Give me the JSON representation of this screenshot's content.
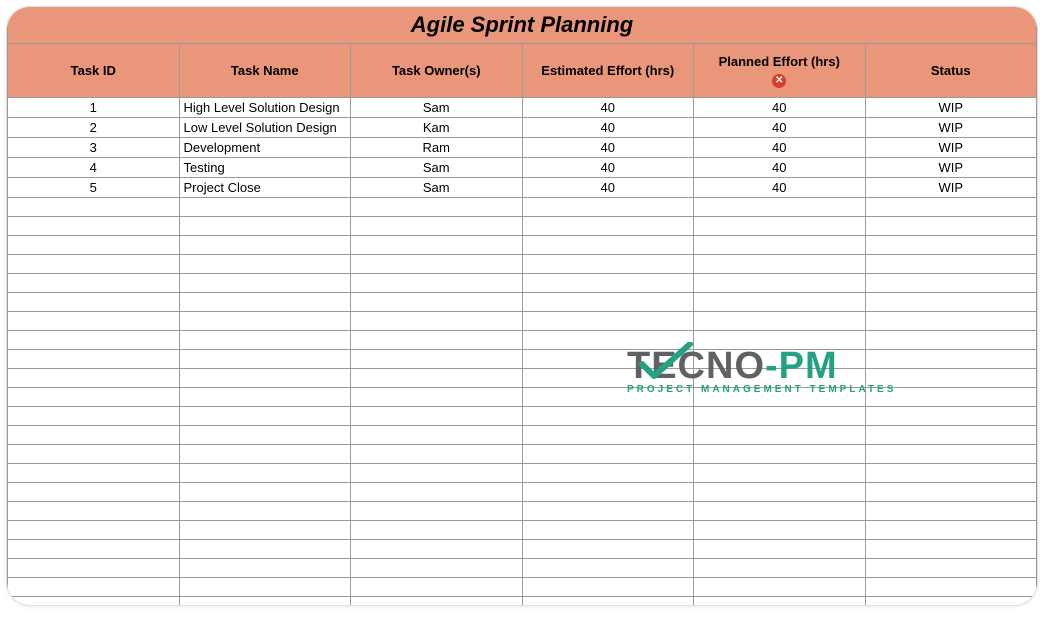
{
  "title": "Agile Sprint Planning",
  "headers": {
    "task_id": "Task ID",
    "task_name": "Task Name",
    "task_owner": "Task Owner(s)",
    "estimated": "Estimated Effort (hrs)",
    "planned": "Planned Effort (hrs)",
    "status": "Status"
  },
  "rows": [
    {
      "id": "1",
      "name": "High Level Solution Design",
      "owner": "Sam",
      "est": "40",
      "plan": "40",
      "status": "WIP"
    },
    {
      "id": "2",
      "name": "Low Level Solution Design",
      "owner": "Kam",
      "est": "40",
      "plan": "40",
      "status": "WIP"
    },
    {
      "id": "3",
      "name": "Development",
      "owner": "Ram",
      "est": "40",
      "plan": "40",
      "status": "WIP"
    },
    {
      "id": "4",
      "name": "Testing",
      "owner": "Sam",
      "est": "40",
      "plan": "40",
      "status": "WIP"
    },
    {
      "id": "5",
      "name": "Project Close",
      "owner": "Sam",
      "est": "40",
      "plan": "40",
      "status": "WIP"
    }
  ],
  "empty_row_count": 22,
  "watermark": {
    "brand1": "TEC",
    "brand2": "NO",
    "brand3": "-PM",
    "subtitle": "PROJECT MANAGEMENT TEMPLATES"
  },
  "icons": {
    "error_glyph": "✕"
  }
}
